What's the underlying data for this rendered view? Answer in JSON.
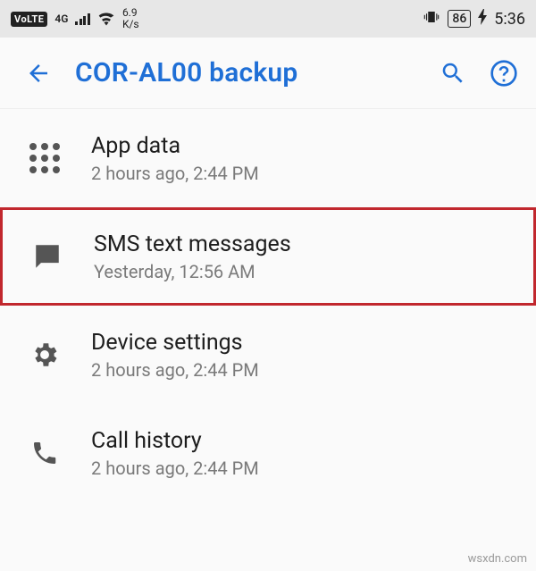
{
  "status_bar": {
    "volte": "VoLTE",
    "signal_gen": "4G",
    "speed_num": "6.9",
    "speed_unit": "K/s",
    "battery_pct": "86",
    "clock": "5:36"
  },
  "app_bar": {
    "title": "COR-AL00 backup",
    "back_icon": "back-arrow",
    "search_icon": "search",
    "help_icon": "help"
  },
  "items": [
    {
      "icon": "apps-grid",
      "title": "App data",
      "subtitle": "2 hours ago, 2:44 PM",
      "highlight": false
    },
    {
      "icon": "sms",
      "title": "SMS text messages",
      "subtitle": "Yesterday, 12:56 AM",
      "highlight": true
    },
    {
      "icon": "settings-gear",
      "title": "Device settings",
      "subtitle": "2 hours ago, 2:44 PM",
      "highlight": false
    },
    {
      "icon": "phone",
      "title": "Call history",
      "subtitle": "2 hours ago, 2:44 PM",
      "highlight": false
    }
  ],
  "watermark": "wsxdn.com"
}
